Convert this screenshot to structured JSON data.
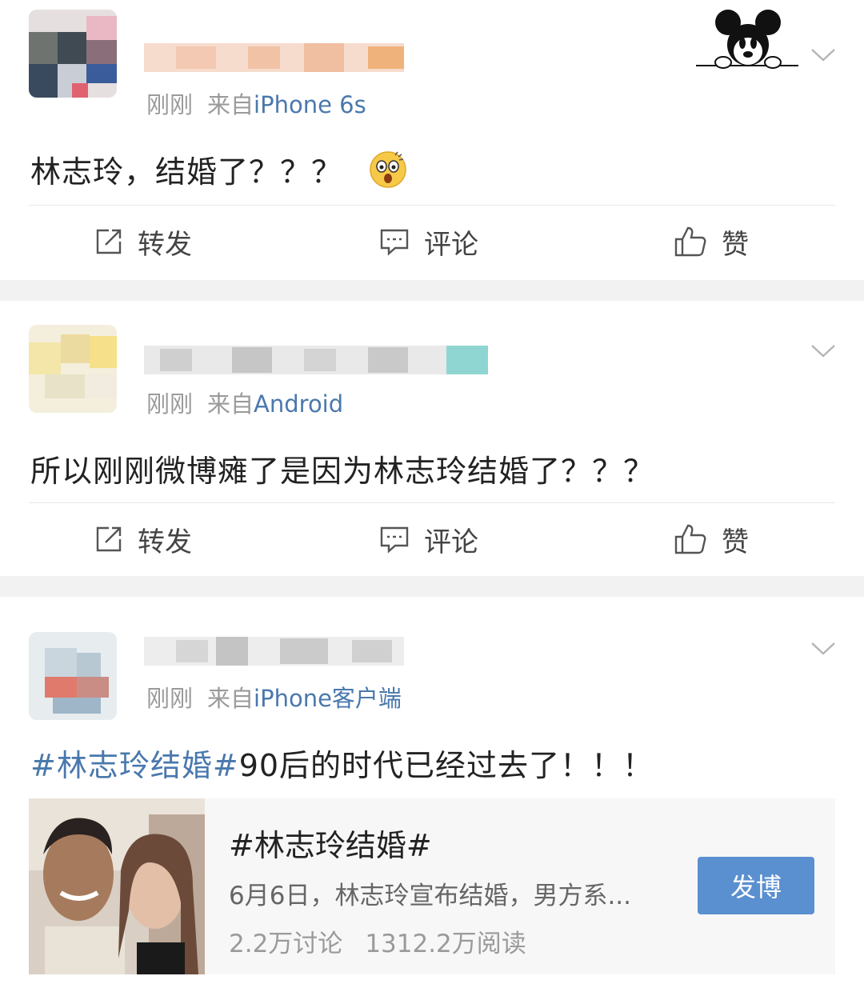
{
  "posts": [
    {
      "time": "刚刚",
      "source_label": "来自",
      "device": "iPhone 6s",
      "text": "林志玲，结婚了？？？",
      "emoji_icon": "shocked-face-icon",
      "has_badge": true
    },
    {
      "time": "刚刚",
      "source_label": "来自",
      "device": "Android",
      "text": "所以刚刚微博瘫了是因为林志玲结婚了？？？"
    },
    {
      "time": "刚刚",
      "source_label": "来自",
      "device": "iPhone客户端",
      "hashtag": "#林志玲结婚#",
      "text": "90后的时代已经过去了！！！"
    }
  ],
  "actions": {
    "repost": "转发",
    "comment": "评论",
    "like": "赞"
  },
  "topic_card": {
    "title": "#林志玲结婚#",
    "description": "6月6日，林志玲宣布结婚，男方系...",
    "discussions": "2.2万讨论",
    "reads": "1312.2万阅读",
    "post_button": "发博"
  },
  "colors": {
    "link_blue": "#4a78ad",
    "button_blue": "#5a8fd0",
    "meta_gray": "#9a9a9a",
    "background": "#f2f2f2"
  }
}
